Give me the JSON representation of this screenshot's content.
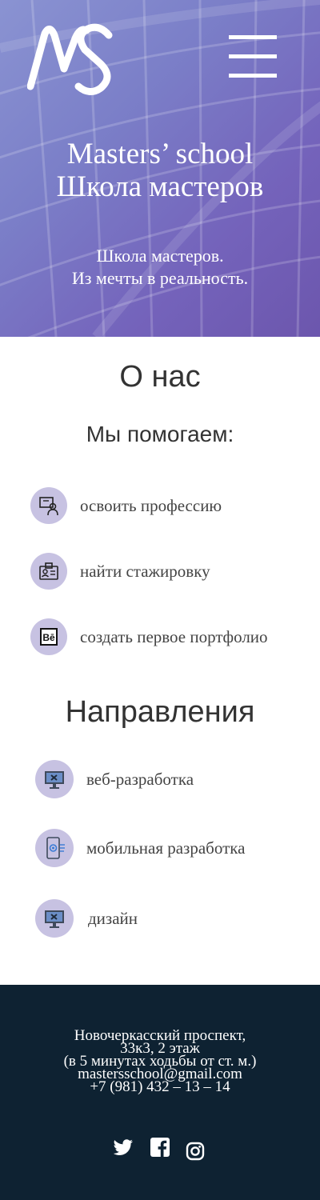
{
  "hero": {
    "title_line1": "Masters’ school",
    "title_line2": "Школа мастеров",
    "subtitle_line1": "Школа мастеров.",
    "subtitle_line2": "Из мечты в реальность."
  },
  "about": {
    "title": "О нас",
    "help_title": "Мы помогаем:",
    "items": [
      {
        "label": "освоить профессию",
        "icon": "teacher-board-icon"
      },
      {
        "label": "найти стажировку",
        "icon": "id-badge-icon"
      },
      {
        "label": "создать первое портфолио",
        "icon": "behance-icon"
      }
    ]
  },
  "directions": {
    "title": "Направления",
    "items": [
      {
        "label": "веб-разработка",
        "icon": "monitor-tools-icon"
      },
      {
        "label": "мобильная разработка",
        "icon": "mobile-settings-icon"
      },
      {
        "label": "дизайн",
        "icon": "monitor-design-icon"
      }
    ]
  },
  "footer": {
    "address_line1": "Новочеркасский проспект,",
    "address_line2": "33к3, 2 этаж",
    "address_line3": "(в 5 минутах ходьбы от ст. м.)",
    "email": "mastersschool@gmail.com",
    "phone": "+7 (981) 432 – 13 – 14",
    "social": [
      "twitter-icon",
      "facebook-icon",
      "instagram-icon"
    ]
  },
  "colors": {
    "hero_start": "#8a93d2",
    "hero_end": "#6c56ad",
    "icon_circle": "#c7c2e2",
    "footer_bg": "#0e2232"
  }
}
